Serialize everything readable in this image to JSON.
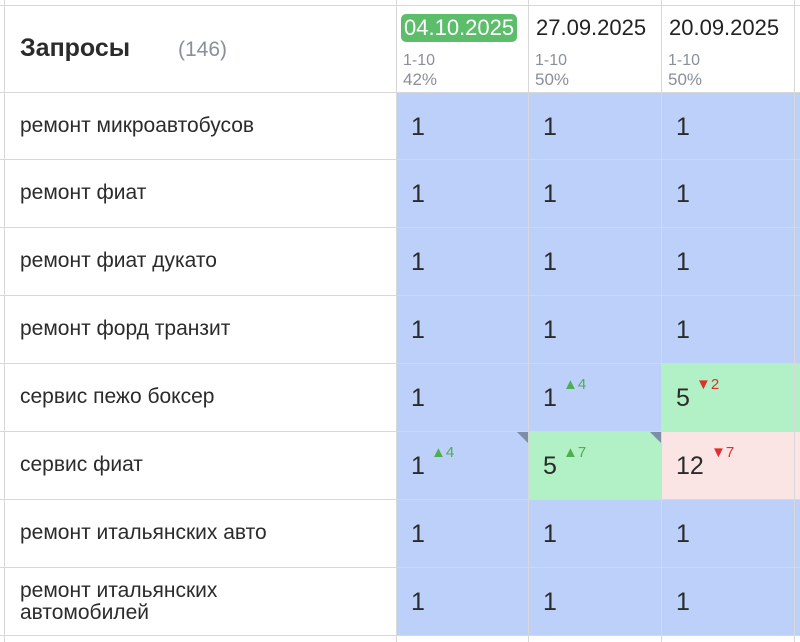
{
  "header": {
    "title": "Запросы",
    "count": "(146)"
  },
  "columns": [
    {
      "date": "04.10.2025",
      "range": "1-10",
      "percent": "42%",
      "active": true
    },
    {
      "date": "27.09.2025",
      "range": "1-10",
      "percent": "50%",
      "active": false
    },
    {
      "date": "20.09.2025",
      "range": "1-10",
      "percent": "50%",
      "active": false
    }
  ],
  "rows": [
    {
      "query": "ремонт микроавтобусов",
      "cells": [
        {
          "value": "1",
          "delta": "",
          "dir": "",
          "color": "blue"
        },
        {
          "value": "1",
          "delta": "",
          "dir": "",
          "color": "blue"
        },
        {
          "value": "1",
          "delta": "",
          "dir": "",
          "color": "blue"
        }
      ]
    },
    {
      "query": "ремонт фиат",
      "cells": [
        {
          "value": "1",
          "delta": "",
          "dir": "",
          "color": "blue"
        },
        {
          "value": "1",
          "delta": "",
          "dir": "",
          "color": "blue"
        },
        {
          "value": "1",
          "delta": "",
          "dir": "",
          "color": "blue"
        }
      ]
    },
    {
      "query": "ремонт фиат дукато",
      "cells": [
        {
          "value": "1",
          "delta": "",
          "dir": "",
          "color": "blue"
        },
        {
          "value": "1",
          "delta": "",
          "dir": "",
          "color": "blue"
        },
        {
          "value": "1",
          "delta": "",
          "dir": "",
          "color": "blue"
        }
      ]
    },
    {
      "query": "ремонт форд транзит",
      "cells": [
        {
          "value": "1",
          "delta": "",
          "dir": "",
          "color": "blue"
        },
        {
          "value": "1",
          "delta": "",
          "dir": "",
          "color": "blue"
        },
        {
          "value": "1",
          "delta": "",
          "dir": "",
          "color": "blue"
        }
      ]
    },
    {
      "query": "сервис пежо боксер",
      "cells": [
        {
          "value": "1",
          "delta": "",
          "dir": "",
          "color": "blue"
        },
        {
          "value": "1",
          "delta": "▲4",
          "dir": "up",
          "color": "blue"
        },
        {
          "value": "5",
          "delta": "▼2",
          "dir": "down",
          "color": "green"
        }
      ]
    },
    {
      "query": "сервис фиат",
      "cells": [
        {
          "value": "1",
          "delta": "▲4",
          "dir": "up",
          "color": "blue",
          "corner": true
        },
        {
          "value": "5",
          "delta": "▲7",
          "dir": "up",
          "color": "green",
          "corner": true
        },
        {
          "value": "12",
          "delta": "▼7",
          "dir": "down",
          "color": "red"
        }
      ]
    },
    {
      "query": "ремонт итальянских авто",
      "cells": [
        {
          "value": "1",
          "delta": "",
          "dir": "",
          "color": "blue"
        },
        {
          "value": "1",
          "delta": "",
          "dir": "",
          "color": "blue"
        },
        {
          "value": "1",
          "delta": "",
          "dir": "",
          "color": "blue"
        }
      ]
    },
    {
      "query": "ремонт итальянских автомобилей",
      "cells": [
        {
          "value": "1",
          "delta": "",
          "dir": "",
          "color": "blue"
        },
        {
          "value": "1",
          "delta": "",
          "dir": "",
          "color": "blue"
        },
        {
          "value": "1",
          "delta": "",
          "dir": "",
          "color": "blue"
        }
      ]
    }
  ],
  "colors": {
    "blue": "#bcd0fa",
    "green": "#b2f0c6",
    "red": "#fbe4e4",
    "active_date": "#5cbd6b",
    "up": "#4caf50",
    "down": "#e0302e"
  }
}
